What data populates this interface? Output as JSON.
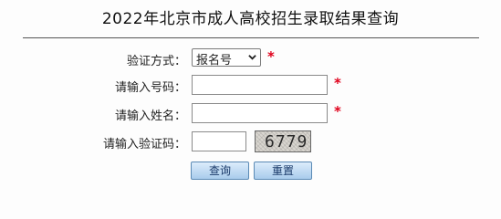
{
  "page": {
    "title": "2022年北京市成人高校招生录取结果查询"
  },
  "form": {
    "method_label": "验证方式：",
    "method_value": "报名号",
    "number_label": "请输入号码：",
    "number_value": "",
    "name_label": "请输入姓名：",
    "name_value": "",
    "captcha_label": "请输入验证码：",
    "captcha_value": "",
    "captcha_code": "6779",
    "required_mark": "*"
  },
  "buttons": {
    "query": "查询",
    "reset": "重置"
  },
  "colors": {
    "required": "#e0001b",
    "button_border": "#5a8ab5",
    "button_text": "#1a3a6a"
  }
}
